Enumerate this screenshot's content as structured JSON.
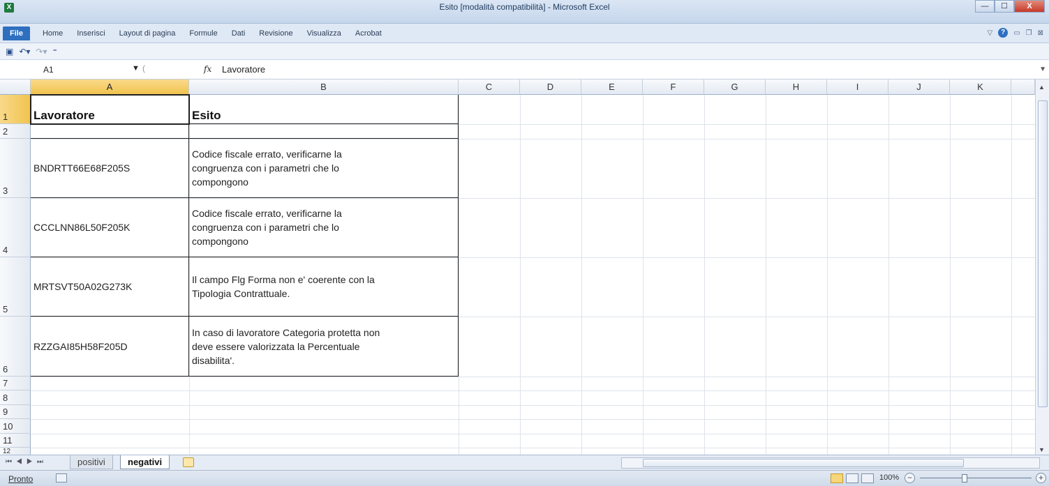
{
  "window": {
    "title": "Esito  [modalità compatibilità]  -  Microsoft Excel",
    "app_icon": "X",
    "buttons": {
      "minimize": "—",
      "maximize": "☐",
      "close": "X"
    }
  },
  "ribbon": {
    "file": "File",
    "tabs": [
      "Home",
      "Inserisci",
      "Layout di pagina",
      "Formule",
      "Dati",
      "Revisione",
      "Visualizza",
      "Acrobat"
    ]
  },
  "qat": {
    "icons": [
      "save-icon",
      "undo-icon",
      "redo-icon",
      "customize-icon"
    ]
  },
  "formula_bar": {
    "name_box": "A1",
    "fx": "fx",
    "content": "Lavoratore"
  },
  "columns": [
    "A",
    "B",
    "C",
    "D",
    "E",
    "F",
    "G",
    "H",
    "I",
    "J",
    "K"
  ],
  "rows": [
    "1",
    "2",
    "3",
    "4",
    "5",
    "6",
    "7",
    "8",
    "9",
    "10",
    "11",
    "12"
  ],
  "table": {
    "headers": [
      "Lavoratore",
      "Esito"
    ],
    "records": [
      {
        "worker": "BNDRTT66E68F205S",
        "outcome": " Codice fiscale errato, verificarne la\ncongruenza con i parametri che lo\ncompongono"
      },
      {
        "worker": "CCCLNN86L50F205K",
        "outcome": " Codice fiscale errato, verificarne la\ncongruenza con i parametri che lo\ncompongono"
      },
      {
        "worker": "MRTSVT50A02G273K",
        "outcome": " Il campo Flg Forma non e' coerente con la\nTipologia Contrattuale."
      },
      {
        "worker": "RZZGAI85H58F205D",
        "outcome": " In caso di lavoratore Categoria protetta non\ndeve essere valorizzata la Percentuale\ndisabilita'."
      }
    ]
  },
  "sheets": {
    "tabs": [
      "positivi",
      "negativi"
    ],
    "active": "negativi"
  },
  "status": {
    "ready": "Pronto",
    "zoom": "100%"
  },
  "colors": {
    "selected_header": "#f1c44f",
    "file_tab": "#2e6fbf"
  }
}
